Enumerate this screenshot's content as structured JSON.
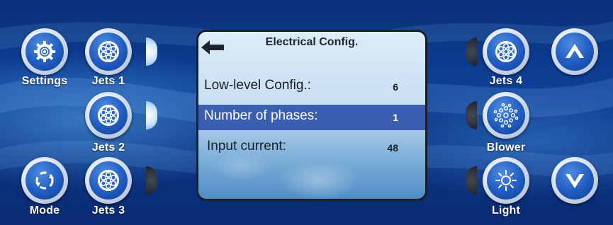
{
  "screen": {
    "title": "Electrical Config.",
    "rows": [
      {
        "label": "Low-level Config.:",
        "value": "6",
        "selected": false
      },
      {
        "label": "Number of phases:",
        "value": "1",
        "selected": true
      },
      {
        "label": "Input current:",
        "value": "48",
        "selected": false
      }
    ]
  },
  "buttons": {
    "settings": "Settings",
    "jets1": "Jets 1",
    "jets2": "Jets 2",
    "jets3": "Jets 3",
    "mode": "Mode",
    "jets4": "Jets 4",
    "blower": "Blower",
    "light": "Light"
  },
  "indicators": {
    "jets1": "on",
    "jets2": "on",
    "jets3": "off",
    "jets4": "off",
    "blower": "off",
    "light": "off"
  },
  "colors": {
    "background": "#0a2f78",
    "button_blue": "#1f5cc0",
    "selected_row": "#3b5fb0",
    "indicator_on": "#cfe6ff",
    "indicator_off": "#2a2f38"
  }
}
